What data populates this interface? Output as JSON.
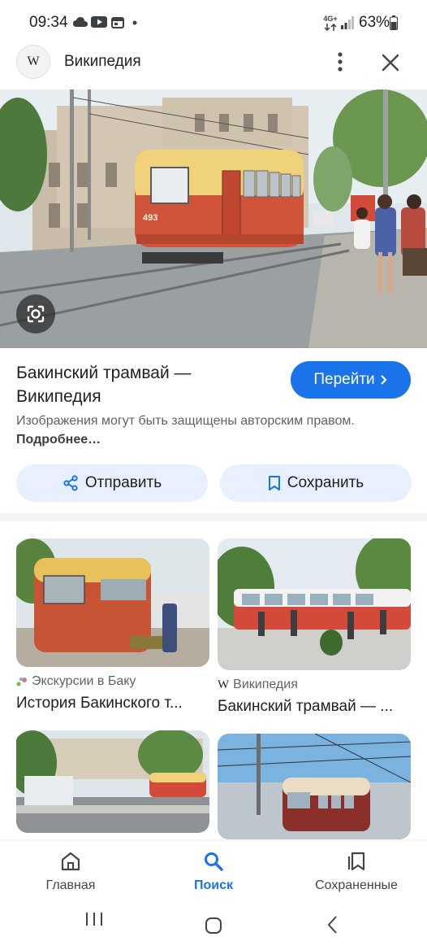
{
  "status_bar": {
    "time": "09:34",
    "network": "4G+",
    "battery": "63%"
  },
  "header": {
    "logo_text": "W",
    "title": "Википедия",
    "icons": [
      "more-vert-icon",
      "close-icon"
    ]
  },
  "hero": {
    "tram_number": "493"
  },
  "result": {
    "title": "Бакинский трамвай — Википедия",
    "visit_label": "Перейти",
    "notice_text": "Изображения могут быть защищены авторским правом.",
    "notice_link": "Подробнее…",
    "share_label": "Отправить",
    "save_label": "Сохранить"
  },
  "related": [
    {
      "source": "Экскурсии в Баку",
      "title": "История Бакинского т..."
    },
    {
      "source": "Википедия",
      "title": "Бакинский трамвай — ..."
    },
    {
      "source": "",
      "title": ""
    },
    {
      "source": "",
      "title": ""
    }
  ],
  "bottom_nav": {
    "home": "Главная",
    "search": "Поиск",
    "saved": "Сохраненные",
    "active": "search"
  },
  "colors": {
    "accent": "#1a73e8",
    "pill_bg": "#e8f0fe",
    "text_secondary": "#5f6368"
  }
}
